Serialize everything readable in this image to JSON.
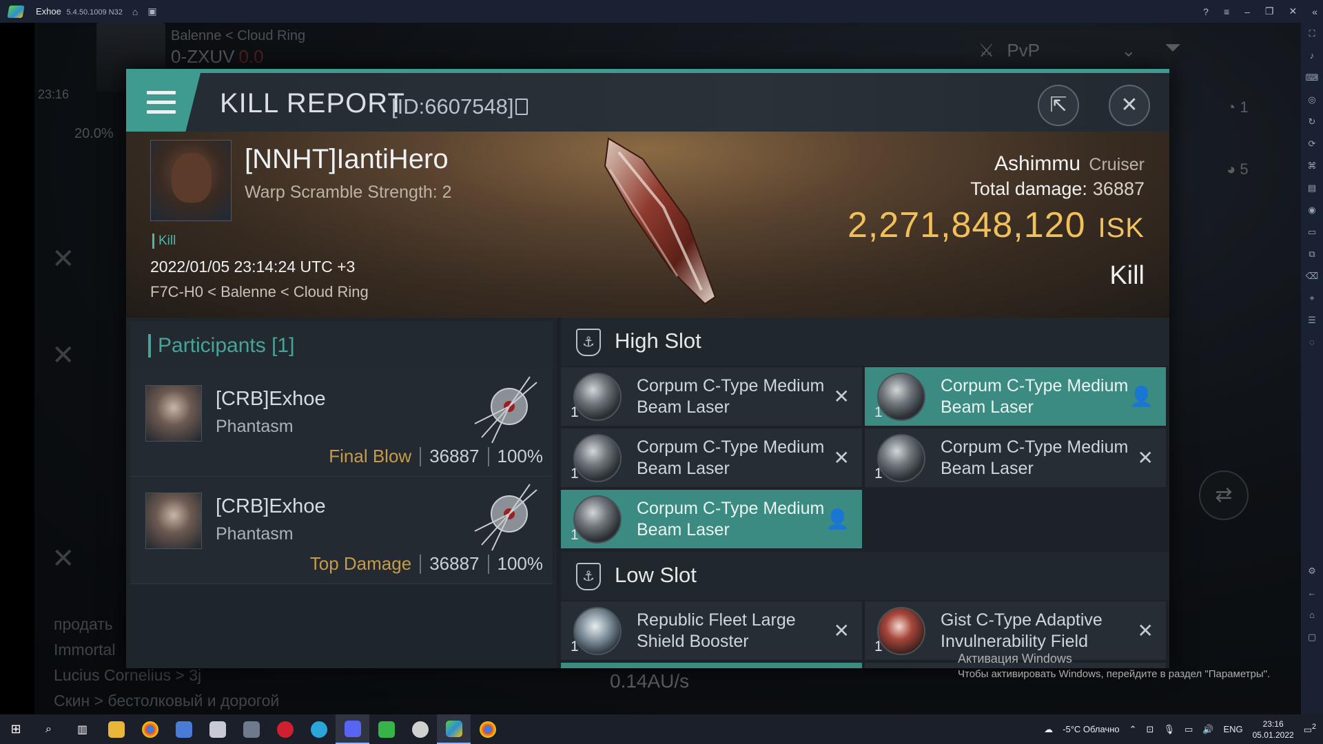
{
  "emulator": {
    "title": "Exhoe",
    "version": "5.4.50.1009 N32",
    "controls": [
      "help-icon",
      "menu-icon",
      "minimize-icon",
      "restore-icon",
      "close-icon"
    ]
  },
  "hud": {
    "location": "Balenne < Cloud Ring",
    "system": "0-ZXUV",
    "security": "0.0",
    "time": "23:16",
    "cargo": "20.0%",
    "pvp_label": "PvP",
    "speed": "0.14AU/s",
    "counter_1": "1",
    "counter_2": "5",
    "chat_lines": [
      "продать",
      "Immortal",
      "Lucius Cornelius > 3j",
      "Скин > бестолковый и дорогой"
    ]
  },
  "report": {
    "title": "KILL REPORT",
    "id": "[ID:6607548]",
    "victim": {
      "name": "[NNHT]IantiHero",
      "subtitle": "Warp Scramble Strength: 2",
      "tag": "Kill",
      "datetime": "2022/01/05 23:14:24 UTC +3",
      "location": "F7C-H0 < Balenne < Cloud Ring"
    },
    "ship": {
      "name": "Ashimmu",
      "class": "Cruiser",
      "total_damage_label": "Total damage:",
      "total_damage": "36887",
      "isk_value": "2,271,848,120",
      "isk_unit": "ISK",
      "kill_type": "Kill"
    }
  },
  "participants": {
    "header": "Participants [1]",
    "rows": [
      {
        "name": "[CRB]Exhoe",
        "ship": "Phantasm",
        "role": "Final Blow",
        "damage": "36887",
        "percent": "100%"
      },
      {
        "name": "[CRB]Exhoe",
        "ship": "Phantasm",
        "role": "Top Damage",
        "damage": "36887",
        "percent": "100%"
      }
    ]
  },
  "modules": {
    "high_slot_label": "High Slot",
    "low_slot_label": "Low Slot",
    "high": [
      {
        "qty": "1",
        "name": "Corpum C-Type Medium Beam Laser",
        "status": "destroyed",
        "icon": "laser-icon"
      },
      {
        "qty": "1",
        "name": "Corpum C-Type Medium Beam Laser",
        "status": "dropped",
        "icon": "laser-icon"
      },
      {
        "qty": "1",
        "name": "Corpum C-Type Medium Beam Laser",
        "status": "destroyed",
        "icon": "laser-icon"
      },
      {
        "qty": "1",
        "name": "Corpum C-Type Medium Beam Laser",
        "status": "destroyed",
        "icon": "laser-icon"
      },
      {
        "qty": "1",
        "name": "Corpum C-Type Medium Beam Laser",
        "status": "dropped",
        "icon": "laser-icon"
      }
    ],
    "low": [
      {
        "qty": "1",
        "name": "Republic Fleet Large Shield Booster",
        "status": "destroyed",
        "icon": "shield-booster-icon"
      },
      {
        "qty": "1",
        "name": "Gist C-Type Adaptive Invulnerability Field",
        "status": "destroyed",
        "icon": "invulnerability-field-icon"
      }
    ]
  },
  "watermark": {
    "line1": "Активация Windows",
    "line2": "Чтобы активировать Windows, перейдите в раздел \"Параметры\"."
  },
  "taskbar": {
    "weather": "-5°C  Облачно",
    "lang": "ENG",
    "time": "23:16",
    "date": "05.01.2022",
    "notifications": "2"
  },
  "colors": {
    "accent": "#3f9a90",
    "isk": "#f0c05a",
    "final_blow": "#c79b47"
  }
}
